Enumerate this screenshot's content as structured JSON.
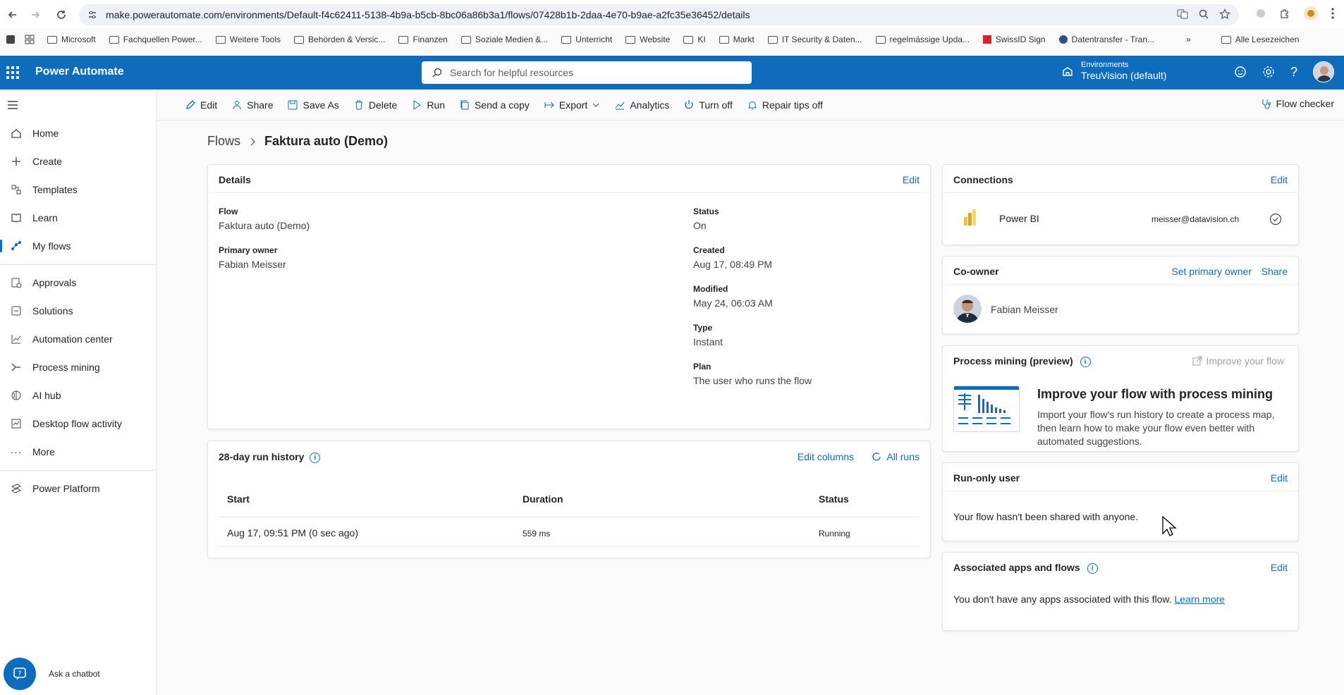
{
  "browser": {
    "url": "make.powerautomate.com/environments/Default-f4c62411-5138-4b9a-b5cb-8bc06a86b3a1/flows/07428b1b-2daa-4e70-b9ae-a2fc35e36452/details",
    "bookmarks": [
      "Microsoft",
      "Fachquellen Power...",
      "Weitere Tools",
      "Behörden & Versic...",
      "Finanzen",
      "Soziale Medien &...",
      "Unterricht",
      "Website",
      "KI",
      "Markt",
      "IT Security & Daten...",
      "regelmässige Upda...",
      "SwissID Sign",
      "Datentransfer - Tran..."
    ],
    "all_bookmarks": "Alle Lesezeichen"
  },
  "header": {
    "app_name": "Power Automate",
    "search_placeholder": "Search for helpful resources",
    "env_label": "Environments",
    "env_name": "TreuVision (default)"
  },
  "sidebar": {
    "items": [
      "Home",
      "Create",
      "Templates",
      "Learn",
      "My flows",
      "Approvals",
      "Solutions",
      "Automation center",
      "Process mining",
      "AI hub",
      "Desktop flow activity",
      "More"
    ],
    "platform": "Power Platform",
    "chatbot": "Ask a chatbot"
  },
  "commands": {
    "edit": "Edit",
    "share": "Share",
    "save_as": "Save As",
    "delete": "Delete",
    "run": "Run",
    "send_copy": "Send a copy",
    "export": "Export",
    "analytics": "Analytics",
    "turn_off": "Turn off",
    "repair_tips": "Repair tips off",
    "flow_checker": "Flow checker"
  },
  "breadcrumb": {
    "root": "Flows",
    "current": "Faktura auto (Demo)"
  },
  "details": {
    "title": "Details",
    "edit": "Edit",
    "flow_label": "Flow",
    "flow_value": "Faktura auto (Demo)",
    "owner_label": "Primary owner",
    "owner_value": "Fabian Meisser",
    "status_label": "Status",
    "status_value": "On",
    "created_label": "Created",
    "created_value": "Aug 17, 08:49 PM",
    "modified_label": "Modified",
    "modified_value": "May 24, 06:03 AM",
    "type_label": "Type",
    "type_value": "Instant",
    "plan_label": "Plan",
    "plan_value": "The user who runs the flow"
  },
  "run_history": {
    "title": "28-day run history",
    "edit_columns": "Edit columns",
    "all_runs": "All runs",
    "columns": [
      "Start",
      "Duration",
      "Status"
    ],
    "rows": [
      {
        "start": "Aug 17, 09:51 PM (0 sec ago)",
        "duration": "559 ms",
        "status": "Running"
      }
    ]
  },
  "connections": {
    "title": "Connections",
    "edit": "Edit",
    "name": "Power BI",
    "account": "meisser@datavision.ch"
  },
  "coowner": {
    "title": "Co-owner",
    "set_primary": "Set primary owner",
    "share": "Share",
    "name": "Fabian Meisser"
  },
  "process_mining": {
    "title": "Process mining (preview)",
    "improve_link": "Improve your flow",
    "headline": "Improve your flow with process mining",
    "body": "Import your flow's run history to create a process map, then learn how to make your flow even better with automated suggestions."
  },
  "run_only": {
    "title": "Run-only user",
    "edit": "Edit",
    "text": "Your flow hasn't been shared with anyone."
  },
  "associated": {
    "title": "Associated apps and flows",
    "edit": "Edit",
    "text": "You don't have any apps associated with this flow.",
    "learn_more": "Learn more"
  },
  "colors": {
    "brand": "#0f6cbd",
    "background": "#fafafa"
  }
}
